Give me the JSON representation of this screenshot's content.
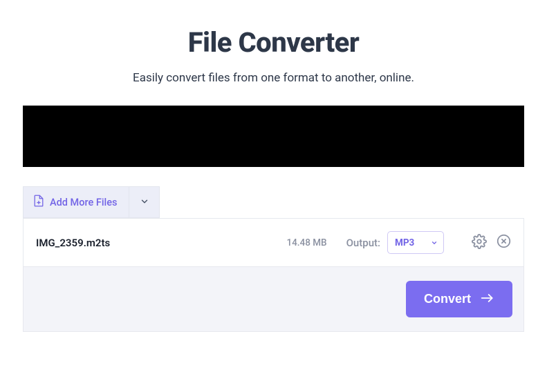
{
  "header": {
    "title": "File Converter",
    "subtitle": "Easily convert files from one format to another, online."
  },
  "toolbar": {
    "add_more_label": "Add More Files"
  },
  "files": [
    {
      "name": "IMG_2359.m2ts",
      "size": "14.48 MB",
      "output_label": "Output:",
      "output_format": "MP3"
    }
  ],
  "actions": {
    "convert_label": "Convert"
  }
}
